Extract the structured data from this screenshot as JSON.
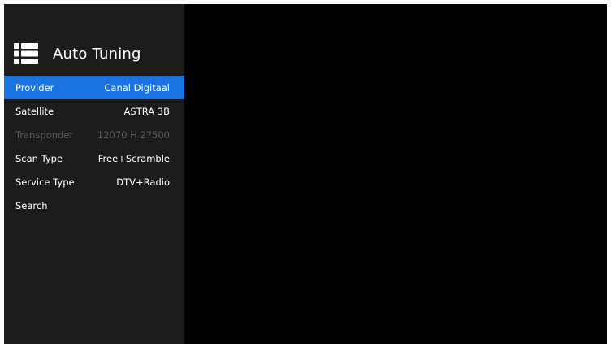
{
  "colors": {
    "background": "#000000",
    "panel": "#1c1c1c",
    "highlight": "#1a73e0",
    "text": "#ffffff",
    "disabled_text": "#5a5a5a"
  },
  "header": {
    "icon": "list-menu-icon",
    "title": "Auto Tuning"
  },
  "menu": {
    "selected_index": 0,
    "items": [
      {
        "label": "Provider",
        "value": "Canal Digitaal",
        "state": "selected"
      },
      {
        "label": "Satellite",
        "value": "ASTRA 3B",
        "state": "normal"
      },
      {
        "label": "Transponder",
        "value": "12070 H 27500",
        "state": "disabled"
      },
      {
        "label": "Scan Type",
        "value": "Free+Scramble",
        "state": "normal"
      },
      {
        "label": "Service Type",
        "value": "DTV+Radio",
        "state": "normal"
      },
      {
        "label": "Search",
        "value": "",
        "state": "normal"
      }
    ]
  }
}
